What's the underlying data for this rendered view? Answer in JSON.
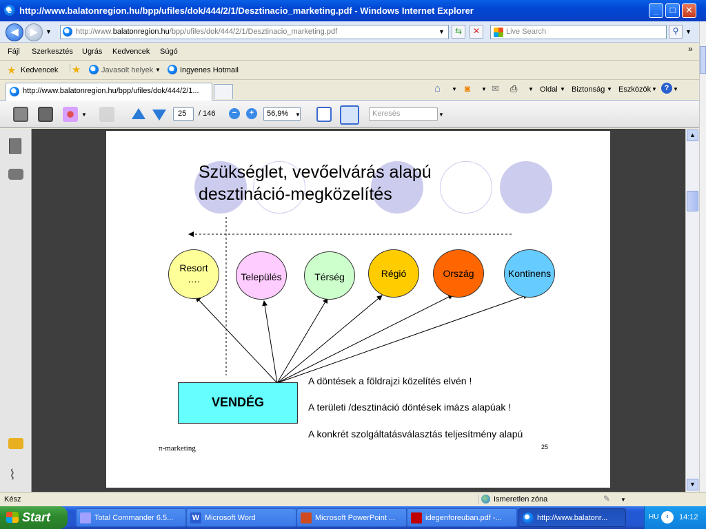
{
  "window": {
    "title": "http://www.balatonregion.hu/bpp/ufiles/dok/444/2/1/Desztinacio_marketing.pdf - Windows Internet Explorer",
    "minimize": "_",
    "maximize": "□",
    "close": "✕"
  },
  "address": {
    "url_prefix": "http://www.",
    "url_domain": "balatonregion.hu",
    "url_path": "/bpp/ufiles/dok/444/2/1/Desztinacio_marketing.pdf",
    "search_placeholder": "Live Search"
  },
  "menu": [
    "Fájl",
    "Szerkesztés",
    "Ugrás",
    "Kedvencek",
    "Súgó"
  ],
  "favorites": {
    "label": "Kedvencek",
    "suggested": "Javasolt helyek",
    "hotmail": "Ingyenes Hotmail"
  },
  "tab": {
    "label": "http://www.balatonregion.hu/bpp/ufiles/dok/444/2/1..."
  },
  "commandbar": {
    "page": "Oldal",
    "safety": "Biztonság",
    "tools": "Eszközök"
  },
  "pdf_toolbar": {
    "page_current": "25",
    "page_total": "/ 146",
    "zoom": "56,9%",
    "find_placeholder": "Keresés"
  },
  "slide": {
    "title_line1": "Szükséglet, vevőelvárás alapú",
    "title_line2": "desztináció-megközelítés",
    "nodes": [
      {
        "label": "Resort",
        "sub": "….",
        "color": "#ffff99"
      },
      {
        "label": "Település",
        "color": "#ffccff"
      },
      {
        "label": "Térség",
        "color": "#ccffcc"
      },
      {
        "label": "Régió",
        "color": "#ffcc00"
      },
      {
        "label": "Ország",
        "color": "#ff6600"
      },
      {
        "label": "Kontinens",
        "color": "#66ccff"
      }
    ],
    "guest": "VENDÉG",
    "guest_color": "#66ffff",
    "bullets": [
      "A döntések a földrajzi közelítés elvén !",
      "A területi /desztináció döntések imázs alapúak !",
      "A konkrét szolgáltatásválasztás teljesítmény alapú"
    ],
    "footer_left": "π-marketing",
    "page_number": "25"
  },
  "status": {
    "text": "Kész",
    "zone": "Ismeretlen zóna"
  },
  "taskbar": {
    "start": "Start",
    "tasks": [
      {
        "label": "Total Commander 6.5...",
        "icon_color": "#a0a0ff"
      },
      {
        "label": "Microsoft Word",
        "icon_color": "#2b5bd0"
      },
      {
        "label": "Microsoft PowerPoint ...",
        "icon_color": "#d04a20"
      },
      {
        "label": "idegenforeuban.pdf -...",
        "icon_color": "#c00000"
      },
      {
        "label": "http://www.balatonr...",
        "icon_color": "#1e90ff"
      }
    ],
    "lang": "HU",
    "clock": "14:12"
  }
}
